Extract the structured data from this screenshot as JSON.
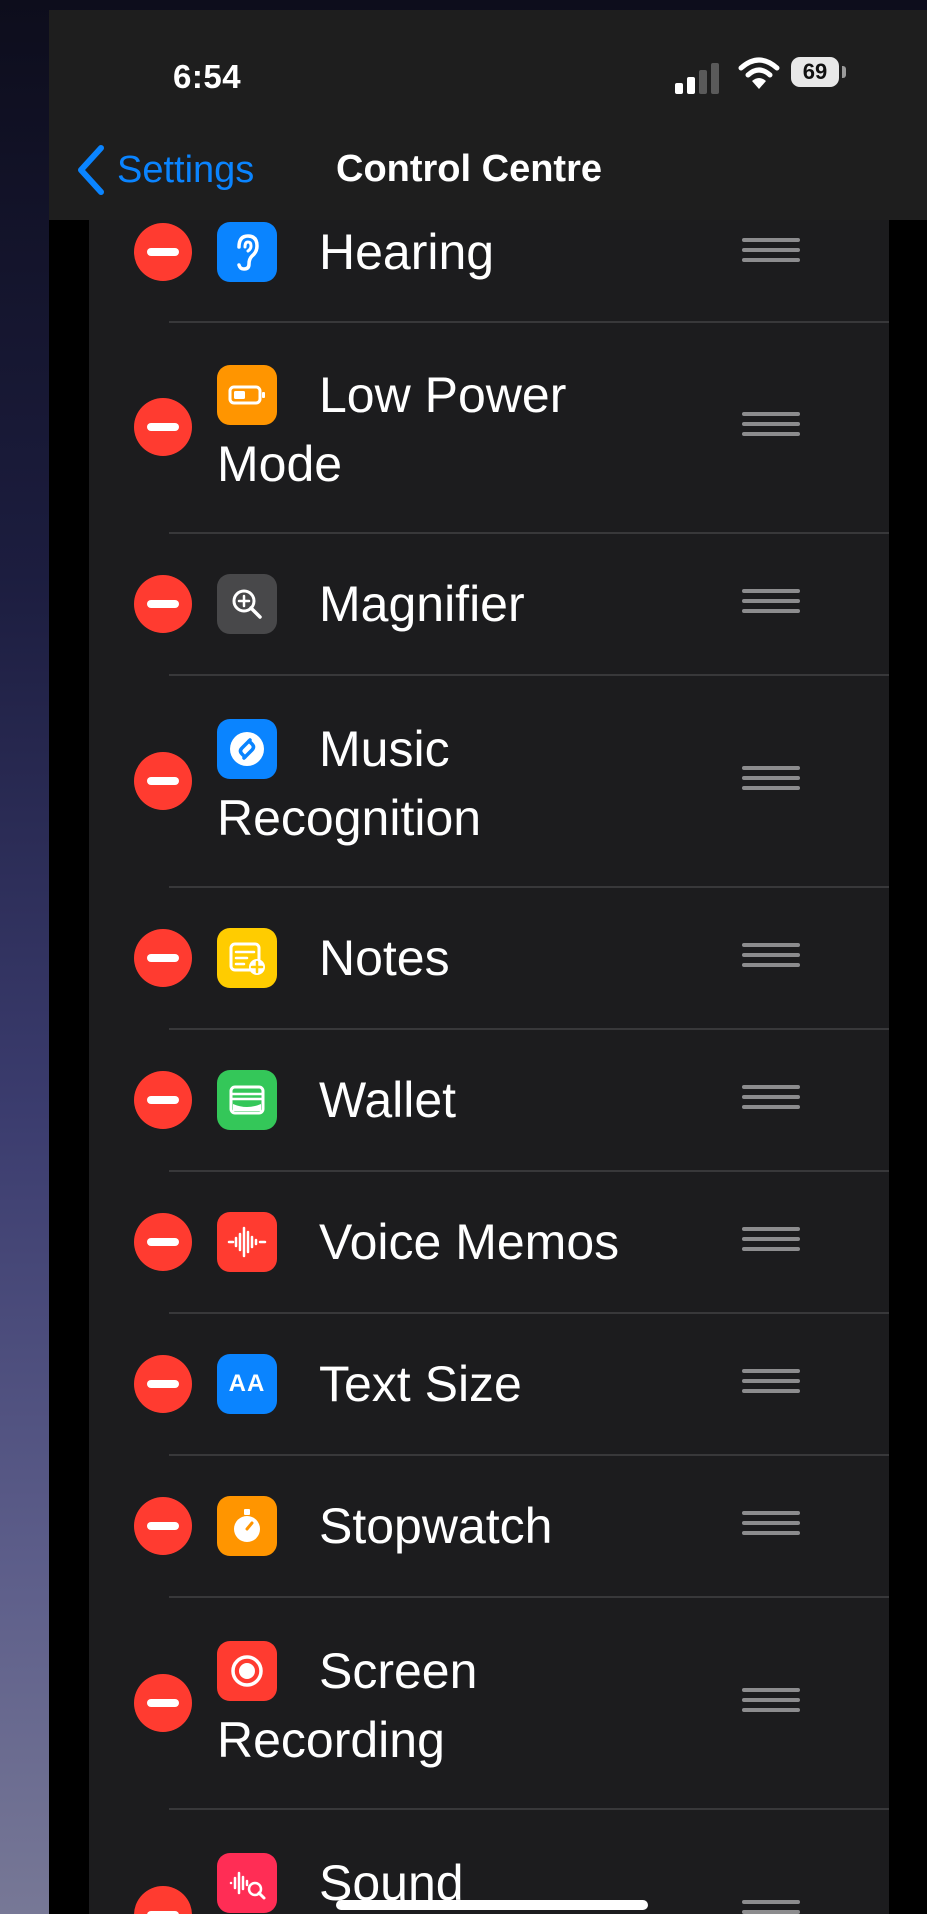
{
  "status_bar": {
    "time": "6:54",
    "battery_level": "69",
    "signal_bars_active": 2,
    "signal_bars_total": 4,
    "icons": [
      "cellular-signal-icon",
      "wifi-icon",
      "battery-icon"
    ]
  },
  "nav": {
    "back_label": "Settings",
    "title": "Control Centre",
    "back_icon": "chevron-left-icon",
    "accent": "#0a84ff"
  },
  "controls": [
    {
      "id": "hearing",
      "label_line1": "Hearing",
      "label_line2": "",
      "icon": "ear-icon",
      "icon_color": "#0a84ff"
    },
    {
      "id": "low-power-mode",
      "label_line1": "Low Power",
      "label_line2": "Mode",
      "icon": "battery-icon",
      "icon_color": "#ff9500"
    },
    {
      "id": "magnifier",
      "label_line1": "Magnifier",
      "label_line2": "",
      "icon": "magnifier-icon",
      "icon_color": "#48484a"
    },
    {
      "id": "music-recognition",
      "label_line1": "Music",
      "label_line2": "Recognition",
      "icon": "shazam-icon",
      "icon_color": "#0a84ff"
    },
    {
      "id": "notes",
      "label_line1": "Notes",
      "label_line2": "",
      "icon": "notes-icon",
      "icon_color": "#ffcc00"
    },
    {
      "id": "wallet",
      "label_line1": "Wallet",
      "label_line2": "",
      "icon": "wallet-icon",
      "icon_color": "#34c759"
    },
    {
      "id": "voice-memos",
      "label_line1": "Voice Memos",
      "label_line2": "",
      "icon": "waveform-icon",
      "icon_color": "#ff3b30"
    },
    {
      "id": "text-size",
      "label_line1": "Text Size",
      "label_line2": "",
      "icon": "text-size-icon",
      "icon_color": "#0a84ff",
      "icon_text": "AA"
    },
    {
      "id": "stopwatch",
      "label_line1": "Stopwatch",
      "label_line2": "",
      "icon": "stopwatch-icon",
      "icon_color": "#ff9500"
    },
    {
      "id": "screen-recording",
      "label_line1": "Screen",
      "label_line2": "Recording",
      "icon": "record-icon",
      "icon_color": "#ff3b30"
    },
    {
      "id": "sound-recognition",
      "label_line1": "Sound",
      "label_line2": "",
      "icon": "sound-recognition-icon",
      "icon_color": "#ff2d55"
    }
  ],
  "colors": {
    "delete": "#ff3b30",
    "row_background": "#1c1c1e",
    "separator": "#38383a"
  }
}
